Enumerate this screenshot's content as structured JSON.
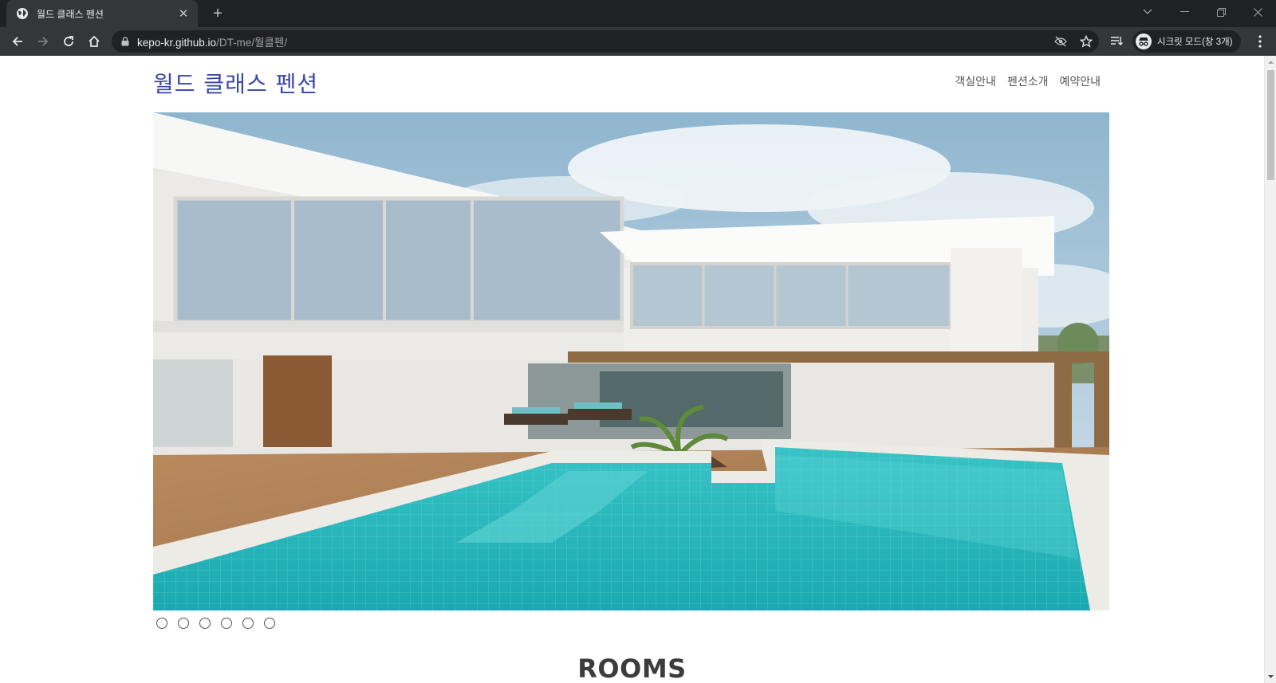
{
  "browser": {
    "tab_title": "월드 클래스 펜션",
    "tab_close": "✕",
    "new_tab": "+",
    "url_host": "kepo-kr.github.io",
    "url_path": "/DT-me/월클펜/",
    "incognito_label": "시크릿 모드(창 3개)"
  },
  "site": {
    "logo": "월드 클래스 펜션",
    "nav": [
      {
        "label": "객실안내"
      },
      {
        "label": "펜션소개"
      },
      {
        "label": "예약안내"
      }
    ]
  },
  "hero": {
    "slides": 6,
    "active_index": 0
  },
  "sections": {
    "rooms_title": "ROOMS"
  },
  "colors": {
    "logo": "#3a46a8",
    "chrome_dark": "#202124",
    "chrome_tab": "#35363a",
    "pool": "#2bbcc0"
  }
}
